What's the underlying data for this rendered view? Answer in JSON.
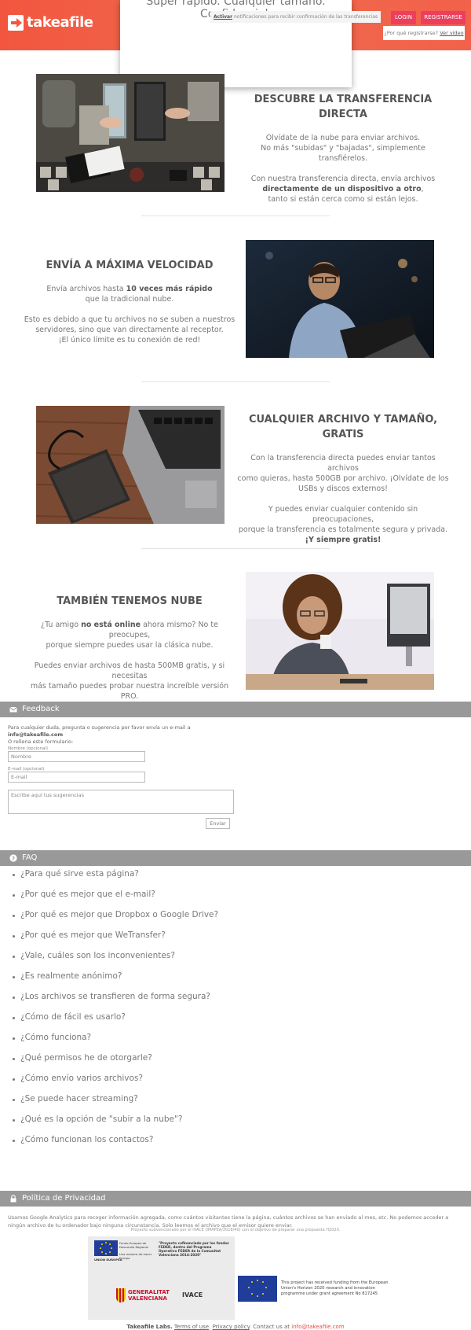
{
  "header": {
    "logo_text": "takeafile",
    "slogan": "Super rápido. Cualquier tamaño. Confidencial.",
    "notify_link": "Activar",
    "notify_text": "notificaciones para recibir confirmación de las transferencias",
    "login_label": "LOGIN",
    "register_label": "REGISTRARSE",
    "why_register": "¿Por qué registrarse?",
    "see_video": "Ver vídeo"
  },
  "sections": {
    "direct": {
      "title": "DESCUBRE LA TRANSFERENCIA DIRECTA",
      "p1a": "Olvídate de la nube para enviar archivos.",
      "p1b": "No más \"subidas\" y \"bajadas\", simplemente transfiérelos.",
      "p2a": "Con nuestra transferencia directa, envía archivos",
      "p2b_bold": "directamente de un dispositivo a otro",
      "p2b_tail": ",",
      "p2c": "tanto si están cerca como si están lejos."
    },
    "speed": {
      "title": "ENVÍA A MÁXIMA VELOCIDAD",
      "p1a": "Envía archivos hasta",
      "p1a_bold": "10 veces más rápido",
      "p1b": "que la tradicional nube.",
      "p2a": "Esto es debido a que tu archivos no se suben a nuestros",
      "p2b": "servidores, sino que van directamente al receptor.",
      "p2c": "¡El único límite es tu conexión de red!"
    },
    "anyfile": {
      "title_a": "CUALQUIER ARCHIVO Y TAMAÑO,",
      "title_b": "GRATIS",
      "p1a": "Con la transferencia directa puedes enviar tantos archivos",
      "p1b": "como quieras, hasta 500GB por archivo. ¡Olvídate de los",
      "p1c": "USBs y discos externos!",
      "p2a": "Y puedes enviar cualquier contenido sin preocupaciones,",
      "p2b": "porque la transferencia es totalmente segura y privada.",
      "p2c_bold": "¡Y siempre gratis!"
    },
    "cloud": {
      "title": "TAMBIÉN TENEMOS NUBE",
      "p1a": "¿Tu amigo",
      "p1a_bold": "no está online",
      "p1a_tail": "ahora mismo? No te preocupes,",
      "p1b": "porque siempre puedes usar la clásica nube.",
      "p2a": "Puedes enviar archivos de hasta 500MB gratis, y si necesitas",
      "p2b": "más tamaño puedes probar nuestra increíble versión PRO."
    }
  },
  "feedback": {
    "title": "Feedback",
    "intro_a": "Para cualquier duda, pregunta o sugerencia por favor envía un e-mail a",
    "email": "info@takeafile.com",
    "intro_b": "O rellena este formulario:",
    "name_label": "Nombre (opcional)",
    "name_placeholder": "Nombre",
    "email_label": "E-mail (opcional)",
    "email_placeholder": "E-mail",
    "message_placeholder": "Escribe aquí tus sugerencias",
    "send_label": "Enviar"
  },
  "faq": {
    "title": "FAQ",
    "items": [
      "¿Para qué sirve esta página?",
      "¿Por qué es mejor que el e-mail?",
      "¿Por qué es mejor que Dropbox o Google Drive?",
      "¿Por qué es mejor que WeTransfer?",
      "¿Vale, cuáles son los inconvenientes?",
      "¿Es realmente anónimo?",
      "¿Los archivos se transfieren de forma segura?",
      "¿Cómo de fácil es usarlo?",
      "¿Cómo funciona?",
      "¿Qué permisos he de otorgarle?",
      "¿Cómo envío varios archivos?",
      "¿Se puede hacer streaming?",
      "¿Qué es la opción de \"subir a la nube\"?",
      "¿Cómo funcionan los contactos?"
    ]
  },
  "privacy": {
    "title": "Política de Privacidad",
    "text": "Usamos Google Analytics para recoger información agregada, como cuántos visitantes tiene la página, cuántos archivos se han enviado al mes, etc. No podemos acceder a ningún archivo de tu ordenador bajo ninguna circunstancia. Solo leemos el archivo que el emisor quiere enviar."
  },
  "funding": {
    "subsidized": "Proyecto subvencionado por el IVACE (IMAPEA/2018/40) con el objetivo de preparar una propuesta H2020.",
    "feder_quote": "\"Proyecto cofinanciado por los fondos FEDER, dentro del Programa Operativo FEDER de la Comunitat Valenciana 2014-2020\"",
    "eu_label": "UNIÓN EUROPEA",
    "eu_sub": "Fondo Europeo de Desarrollo Regional",
    "eu_motto": "Una manera de hacer Europa",
    "gv_a": "GENERALITAT",
    "gv_b": "VALENCIANA",
    "ivace": "IVACE",
    "h2020_text": "This project has received funding from the European Union's Horizon 2020 research and innovation programme under grant agreement No 817245"
  },
  "footer": {
    "company": "Takeafile Labs.",
    "terms": "Terms of use",
    "privacy": "Privacy policy",
    "contact": "Contact us at",
    "email": "info@takeafile.com"
  }
}
